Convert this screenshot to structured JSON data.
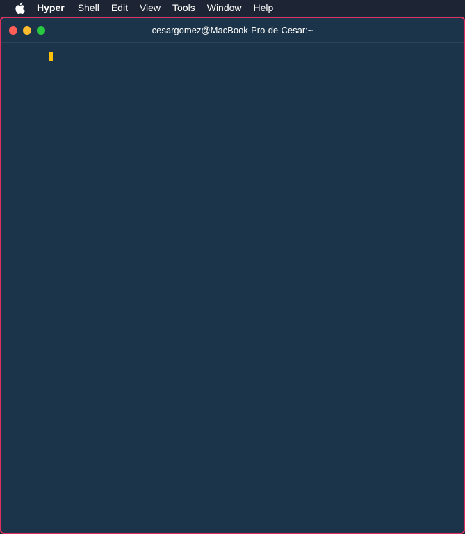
{
  "menubar": {
    "app_name": "Hyper",
    "items": [
      {
        "label": "Shell"
      },
      {
        "label": "Edit"
      },
      {
        "label": "View"
      },
      {
        "label": "Tools"
      },
      {
        "label": "Window"
      },
      {
        "label": "Help"
      }
    ]
  },
  "window": {
    "title": "cesargomez@MacBook-Pro-de-Cesar:~",
    "border_color": "#e0305f",
    "background_color": "#1b3449",
    "cursor_color": "#ffc107"
  },
  "icons": {
    "apple": "apple-icon",
    "close": "close-window-button",
    "minimize": "minimize-window-button",
    "maximize": "maximize-window-button"
  }
}
